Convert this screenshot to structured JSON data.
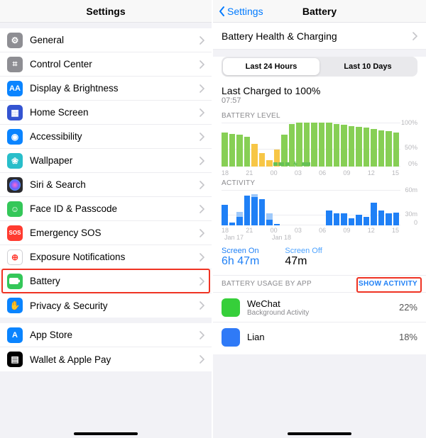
{
  "left": {
    "title": "Settings",
    "groups": [
      [
        {
          "label": "General",
          "color": "#8e8e93",
          "icon": "gear"
        },
        {
          "label": "Control Center",
          "color": "#8e8e93",
          "icon": "switches"
        },
        {
          "label": "Display & Brightness",
          "color": "#0a84ff",
          "icon": "AA"
        },
        {
          "label": "Home Screen",
          "color": "#3454d1",
          "icon": "grid"
        },
        {
          "label": "Accessibility",
          "color": "#0a84ff",
          "icon": "person"
        },
        {
          "label": "Wallpaper",
          "color": "#28beca",
          "icon": "flower"
        },
        {
          "label": "Siri & Search",
          "color": "#2b2b2f",
          "icon": "siri"
        },
        {
          "label": "Face ID & Passcode",
          "color": "#34c759",
          "icon": "face"
        },
        {
          "label": "Emergency SOS",
          "color": "#ff3b30",
          "icon": "SOS"
        },
        {
          "label": "Exposure Notifications",
          "color": "#ffffff",
          "icon": "exposure",
          "border": true
        },
        {
          "label": "Battery",
          "color": "#34c759",
          "icon": "battery",
          "highlight": true
        },
        {
          "label": "Privacy & Security",
          "color": "#0a84ff",
          "icon": "hand"
        }
      ],
      [
        {
          "label": "App Store",
          "color": "#0a84ff",
          "icon": "A"
        },
        {
          "label": "Wallet & Apple Pay",
          "color": "#000000",
          "icon": "wallet"
        }
      ]
    ]
  },
  "right": {
    "back": "Settings",
    "title": "Battery",
    "health_row": "Battery Health & Charging",
    "seg": {
      "a": "Last 24 Hours",
      "b": "Last 10 Days"
    },
    "charged": {
      "line1": "Last Charged to 100%",
      "line2": "07:57"
    },
    "level_hdr": "BATTERY LEVEL",
    "activity_hdr": "ACTIVITY",
    "level_ylab": [
      "100%",
      "50%",
      "0%"
    ],
    "activity_ylab": [
      "60m",
      "30m",
      "0"
    ],
    "hours": [
      "18",
      "21",
      "00",
      "03",
      "06",
      "09",
      "12",
      "15"
    ],
    "dates": [
      "Jan 17",
      "Jan 18"
    ],
    "screen": {
      "on_l": "Screen On",
      "on_v": "6h 47m",
      "off_l": "Screen Off",
      "off_v": "47m"
    },
    "usage_hdr": {
      "l": "BATTERY USAGE BY APP",
      "r": "SHOW ACTIVITY"
    },
    "apps": [
      {
        "name": "WeChat",
        "sub": "Background Activity",
        "pct": "22%",
        "color": "#36cf3a"
      },
      {
        "name": "Lian",
        "sub": "",
        "pct": "18%",
        "color": "#2f7af7"
      }
    ]
  },
  "chart_data": [
    {
      "type": "bar",
      "title": "BATTERY LEVEL",
      "categories": [
        "18",
        "19",
        "20",
        "21",
        "22",
        "23",
        "00",
        "01",
        "02",
        "03",
        "04",
        "05",
        "06",
        "07",
        "08",
        "09",
        "10",
        "11",
        "12",
        "13",
        "14",
        "15",
        "16",
        "17"
      ],
      "series": [
        {
          "name": "battery_level_pct",
          "values": [
            78,
            75,
            72,
            68,
            52,
            30,
            15,
            38,
            72,
            96,
            100,
            100,
            100,
            100,
            100,
            97,
            95,
            92,
            90,
            88,
            86,
            83,
            80,
            78
          ]
        },
        {
          "name": "low_power_mode",
          "values": [
            0,
            0,
            0,
            0,
            52,
            30,
            15,
            38,
            0,
            0,
            0,
            0,
            0,
            0,
            0,
            0,
            0,
            0,
            0,
            0,
            0,
            0,
            0,
            0
          ]
        }
      ],
      "ylabel": "",
      "ylim": [
        0,
        100
      ]
    },
    {
      "type": "bar",
      "title": "ACTIVITY",
      "categories": [
        "18",
        "19",
        "20",
        "21",
        "22",
        "23",
        "00",
        "01",
        "02",
        "03",
        "04",
        "05",
        "06",
        "07",
        "08",
        "09",
        "10",
        "11",
        "12",
        "13",
        "14",
        "15",
        "16",
        "17"
      ],
      "series": [
        {
          "name": "screen_on_min",
          "values": [
            35,
            5,
            15,
            50,
            48,
            45,
            10,
            3,
            0,
            0,
            0,
            0,
            0,
            0,
            25,
            20,
            20,
            12,
            18,
            15,
            38,
            25,
            20,
            22
          ]
        },
        {
          "name": "screen_off_min",
          "values": [
            0,
            0,
            8,
            0,
            5,
            0,
            10,
            0,
            0,
            0,
            0,
            0,
            0,
            0,
            0,
            0,
            0,
            0,
            0,
            0,
            0,
            0,
            0,
            0
          ]
        }
      ],
      "ylabel": "minutes",
      "ylim": [
        0,
        60
      ]
    }
  ]
}
